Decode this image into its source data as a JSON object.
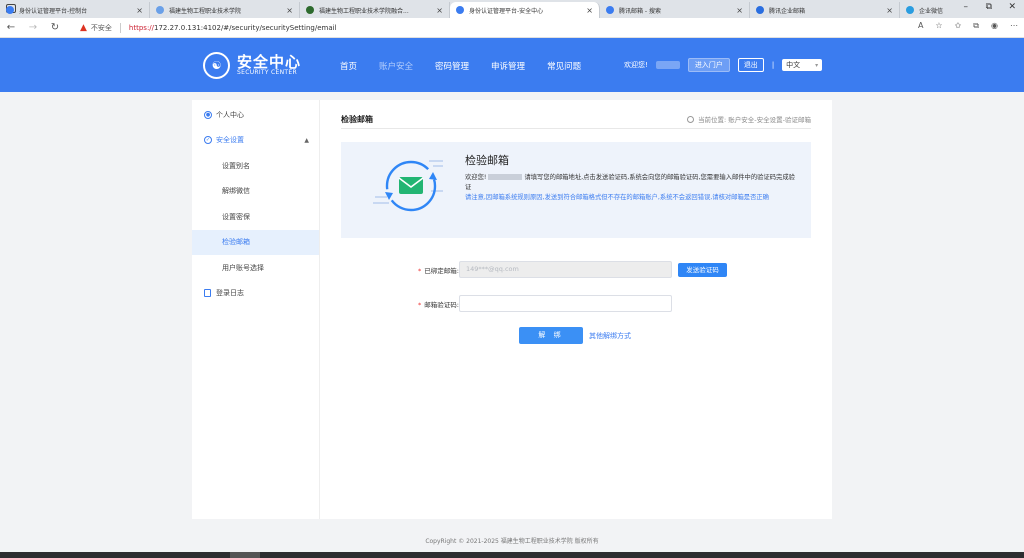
{
  "browser": {
    "tabs": [
      {
        "title": "身份认证管理平台-控制台",
        "color": "#3b7cf0",
        "active": false
      },
      {
        "title": "福建生物工程职业技术学院",
        "color": "#6aa0e8",
        "active": false
      },
      {
        "title": "福建生物工程职业技术学院融合...",
        "color": "#2e6b2e",
        "active": false
      },
      {
        "title": "身份认证管理平台-安全中心",
        "color": "#3b7cf0",
        "active": true
      },
      {
        "title": "腾讯邮箱 - 搜索",
        "color": "#3b7cf0",
        "active": false
      },
      {
        "title": "腾讯企业邮箱",
        "color": "#2a6ee0",
        "active": false
      },
      {
        "title": "企业微信",
        "color": "#2a9de0",
        "active": false
      }
    ],
    "new_tab": "+",
    "insecure_label": "不安全",
    "url_proto": "https://",
    "url_rest": "172.27.0.131:4102/#/security/securitySetting/email"
  },
  "header": {
    "logo_mark": "☯",
    "logo_title": "安全中心",
    "logo_sub": "SECURITY CENTER",
    "nav": [
      {
        "label": "首页",
        "active": false
      },
      {
        "label": "账户安全",
        "active": true
      },
      {
        "label": "密码管理",
        "active": false
      },
      {
        "label": "申诉管理",
        "active": false
      },
      {
        "label": "常见问题",
        "active": false
      }
    ],
    "welcome": "欢迎您!",
    "portal_btn": "进入门户",
    "logout_btn": "退出",
    "lang": "中文"
  },
  "sidebar": {
    "personal": "个人中心",
    "security": "安全设置",
    "sub_items": [
      {
        "label": "设置别名",
        "selected": false
      },
      {
        "label": "解绑微信",
        "selected": false
      },
      {
        "label": "设置密保",
        "selected": false
      },
      {
        "label": "检验邮箱",
        "selected": true
      },
      {
        "label": "用户账号选择",
        "selected": false
      }
    ],
    "login_log": "登录日志"
  },
  "content": {
    "title": "检验邮箱",
    "crumb": "当前位置: 账户安全-安全设置-验证邮箱",
    "info_title": "检验邮箱",
    "info_line1_a": "欢迎您!",
    "info_line1_b": "请填写您的邮箱地址,点击发送验证码,系统会向您的邮箱验证码,您需要输入邮件中的验证码完成验证",
    "info_note": "请注意,因邮箱系统规则原因,发送到符合邮箱格式但不存在的邮箱账户,系统不会返回错误,请核对邮箱是否正确",
    "email_label": "已绑定邮箱:",
    "email_value": "149***@qq.com",
    "send_btn": "发送验证码",
    "code_label": "邮箱验证码:",
    "code_placeholder": "",
    "unbind_btn": "解 绑",
    "other_link": "其他解绑方式"
  },
  "footer": "CopyRight © 2021-2025 福建生物工程职业技术学院 版权所有"
}
